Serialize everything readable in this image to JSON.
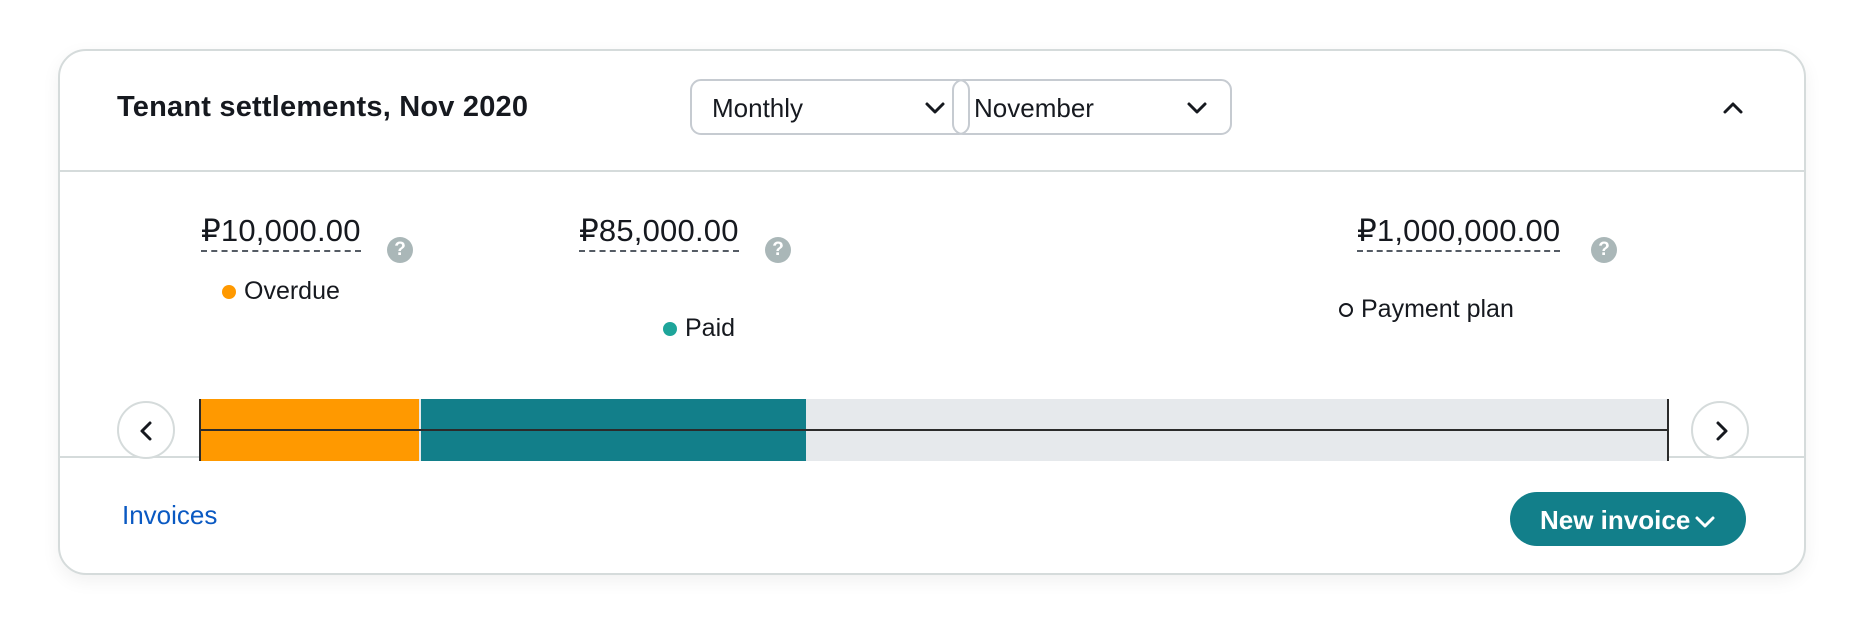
{
  "card": {
    "title": "Tenant settlements, Nov 2020",
    "period_select": {
      "value": "Monthly"
    },
    "month_select": {
      "value": "November"
    }
  },
  "summary": {
    "overdue": {
      "amount": "₽10,000.00",
      "label": "Overdue",
      "color": "#ff9900"
    },
    "paid": {
      "amount": "₽85,000.00",
      "label": "Paid",
      "color": "#1ea59a"
    },
    "payment_plan": {
      "amount": "₽1,000,000.00",
      "label": "Payment plan"
    },
    "help_glyph": "?"
  },
  "progress": {
    "overdue_fraction": 0.149,
    "paid_fraction": 0.262,
    "overdue_color": "#ff9900",
    "paid_color": "#127f8a",
    "remaining_color": "#e6e9ec"
  },
  "footer": {
    "link_label": "Invoices",
    "primary_button_label": "New invoice"
  },
  "icons": [
    "chevron-down-icon",
    "chevron-up-icon",
    "chevron-left-icon",
    "chevron-right-icon",
    "help-icon"
  ]
}
